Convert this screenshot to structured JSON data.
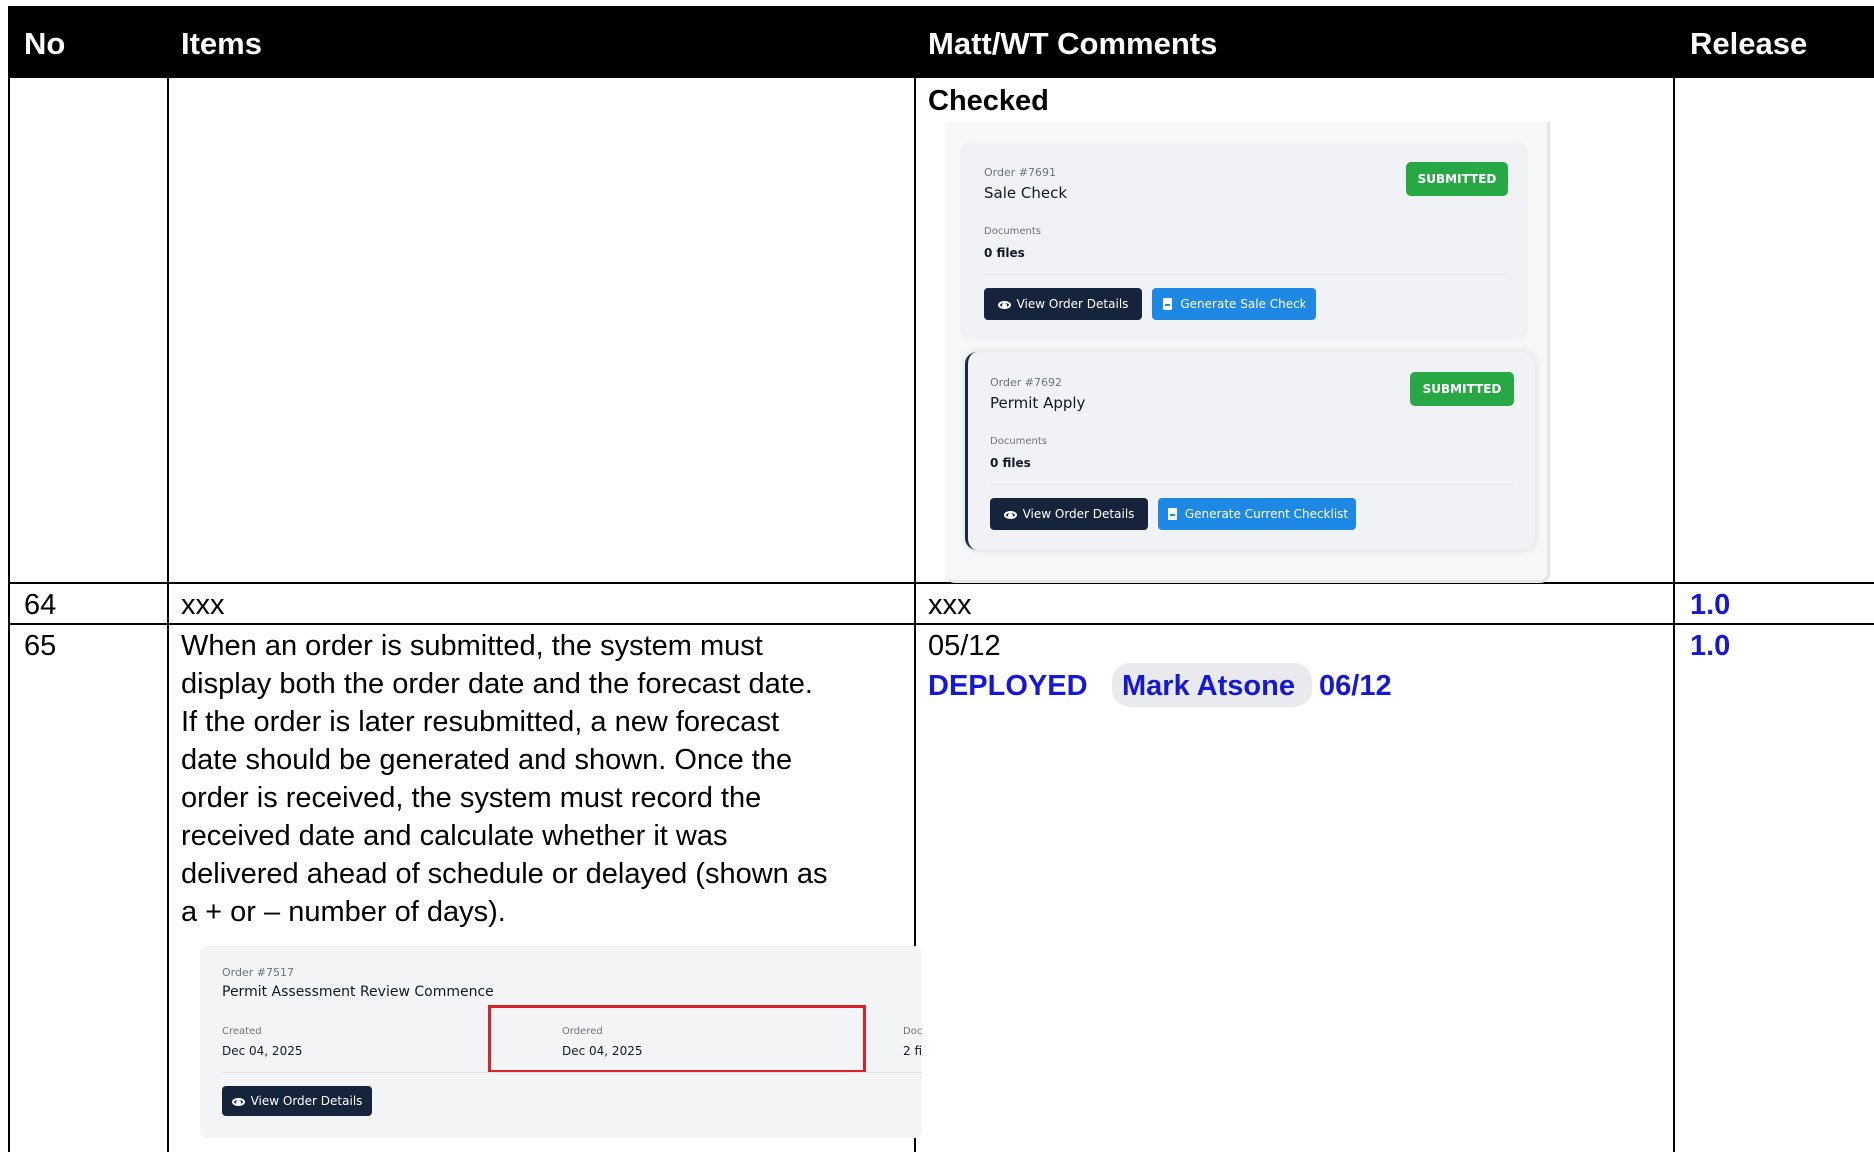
{
  "header": {
    "no": "No",
    "items": "Items",
    "comments": "Matt/WT Comments",
    "release": "Release"
  },
  "row_top": {
    "comment_heading": "Checked",
    "cards": [
      {
        "order": "Order #7691",
        "title": "Sale Check",
        "docs_label": "Documents",
        "docs_value": "0 files",
        "status": "SUBMITTED",
        "view_button": "View Order Details",
        "action_button": "Generate Sale Check",
        "icons": [
          "eye-icon",
          "document-icon"
        ]
      },
      {
        "order": "Order #7692",
        "title": "Permit Apply",
        "docs_label": "Documents",
        "docs_value": "0 files",
        "status": "SUBMITTED",
        "view_button": "View Order Details",
        "action_button": "Generate Current Checklist",
        "icons": [
          "eye-icon",
          "document-icon"
        ]
      }
    ]
  },
  "row_64": {
    "no": "64",
    "item": "xxx",
    "comment": "xxx",
    "release": "1.0"
  },
  "row_65": {
    "no": "65",
    "item_lines": [
      "When an order is submitted, the system must",
      "display both the order date and the forecast date.",
      "If the order is later resubmitted, a new forecast",
      "date should be generated and shown. Once the",
      "order is received, the system must record the",
      "received date and calculate whether it was",
      "delivered ahead of schedule or delayed (shown as",
      "a + or – number of days)."
    ],
    "comment_date": "05/12",
    "deployed": "DEPLOYED",
    "person": "Mark Atsone",
    "deployed_date": "06/12",
    "release": "1.0",
    "screenshot": {
      "order": "Order #7517",
      "title": "Permit Assessment Review Commence",
      "created_label": "Created",
      "created_value": "Dec 04, 2025",
      "ordered_label": "Ordered",
      "ordered_value": "Dec 04, 2025",
      "docs_label": "Doc",
      "docs_value": "2 fi",
      "view_button": "View Order Details"
    }
  },
  "colors": {
    "header_bg": "#000000",
    "release_blue": "#1518d6",
    "badge_green": "#28a745",
    "button_dark": "#15243b",
    "button_blue": "#1e88e5",
    "highlight_red": "#d8232a"
  }
}
